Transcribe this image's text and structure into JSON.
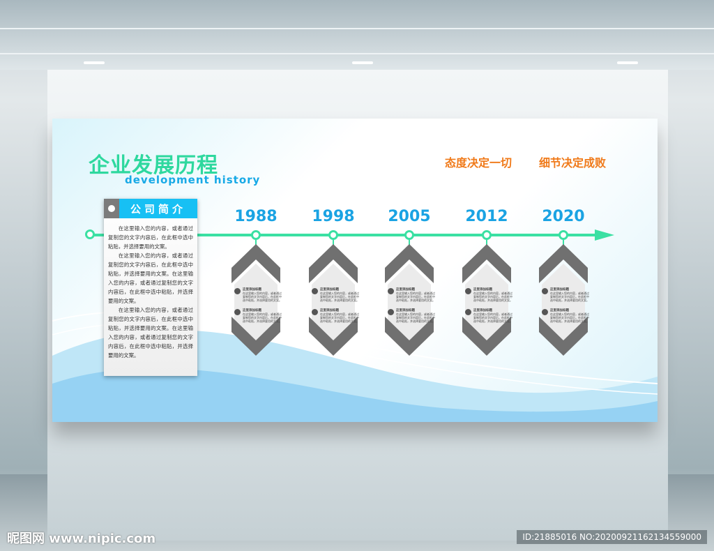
{
  "title": "企业发展历程",
  "subtitle": "development history",
  "slogans": [
    "态度决定一切",
    "细节决定成败"
  ],
  "intro": {
    "heading": "公司简介",
    "paragraphs": [
      "在这里输入您的内容，或者通过复制您的文字内容后，在此框中选中粘贴，并选择要用的文案。",
      "在这里输入您的内容，或者通过复制您的文字内容后，在此框中选中粘贴，并选择要用的文案。在这里输入您的内容，或者通过复制您的文字内容后，在此框中选中粘贴，并选择要用的文案。",
      "在这里输入您的内容，或者通过复制您的文字内容后，在此框中选中粘贴，并选择要用的文案。在这里输入您的内容，或者通过复制您的文字内容后，在此框中选中粘贴，并选择要用的文案。"
    ]
  },
  "milestones": [
    {
      "year": "1988",
      "items": [
        {
          "title": "这里添加标题",
          "text": "在这里输入您的内容，或者通过复制您的文字内容后，在此框中选中粘贴，并选择要用的文案。"
        },
        {
          "title": "这里添加标题",
          "text": "在这里输入您的内容，或者通过复制您的文字内容后，在此框中选中粘贴，并选择要用的文案。"
        }
      ]
    },
    {
      "year": "1998",
      "items": [
        {
          "title": "这里添加标题",
          "text": "在这里输入您的内容，或者通过复制您的文字内容后，在此框中选中粘贴，并选择要用的文案。"
        },
        {
          "title": "这里添加标题",
          "text": "在这里输入您的内容，或者通过复制您的文字内容后，在此框中选中粘贴，并选择要用的文案。"
        }
      ]
    },
    {
      "year": "2005",
      "items": [
        {
          "title": "这里添加标题",
          "text": "在这里输入您的内容，或者通过复制您的文字内容后，在此框中选中粘贴，并选择要用的文案。"
        },
        {
          "title": "这里添加标题",
          "text": "在这里输入您的内容，或者通过复制您的文字内容后，在此框中选中粘贴，并选择要用的文案。"
        }
      ]
    },
    {
      "year": "2012",
      "items": [
        {
          "title": "这里添加标题",
          "text": "在这里输入您的内容，或者通过复制您的文字内容后，在此框中选中粘贴，并选择要用的文案。"
        },
        {
          "title": "这里添加标题",
          "text": "在这里输入您的内容，或者通过复制您的文字内容后，在此框中选中粘贴，并选择要用的文案。"
        }
      ]
    },
    {
      "year": "2020",
      "items": [
        {
          "title": "这里添加标题",
          "text": "在这里输入您的内容，或者通过复制您的文字内容后，在此框中选中粘贴，并选择要用的文案。"
        },
        {
          "title": "这里添加标题",
          "text": "在这里输入您的内容，或者通过复制您的文字内容后，在此框中选中粘贴，并选择要用的文案。"
        }
      ]
    }
  ],
  "watermark": "昵图网 www.nipic.com",
  "image_id": "ID:21885016 NO:20200921162134559000"
}
